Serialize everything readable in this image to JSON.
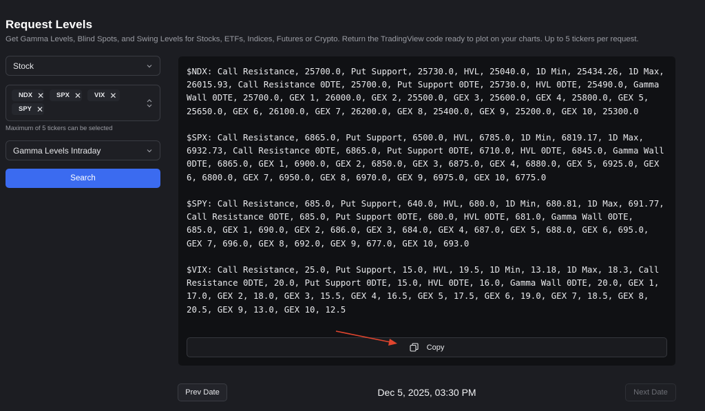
{
  "header": {
    "title": "Request Levels",
    "subtitle": "Get Gamma Levels, Blind Spots, and Swing Levels for Stocks, ETFs, Indices, Futures or Crypto. Return the TradingView code ready to plot on your charts. Up to 5 tickers per request."
  },
  "sidebar": {
    "asset_type": "Stock",
    "tickers": [
      "NDX",
      "SPX",
      "VIX",
      "SPY"
    ],
    "ticker_hint": "Maximum of 5 tickers can be selected",
    "level_type": "Gamma Levels Intraday",
    "search_label": "Search"
  },
  "output": {
    "blocks": [
      "$NDX: Call Resistance, 25700.0, Put Support, 25730.0, HVL, 25040.0, 1D Min, 25434.26, 1D Max, 26015.93, Call Resistance 0DTE, 25700.0, Put Support 0DTE, 25730.0, HVL 0DTE, 25490.0, Gamma Wall 0DTE, 25700.0, GEX 1, 26000.0, GEX 2, 25500.0, GEX 3, 25600.0, GEX 4, 25800.0, GEX 5, 25650.0, GEX 6, 26100.0, GEX 7, 26200.0, GEX 8, 25400.0, GEX 9, 25200.0, GEX 10, 25300.0",
      "$SPX: Call Resistance, 6865.0, Put Support, 6500.0, HVL, 6785.0, 1D Min, 6819.17, 1D Max, 6932.73, Call Resistance 0DTE, 6865.0, Put Support 0DTE, 6710.0, HVL 0DTE, 6845.0, Gamma Wall 0DTE, 6865.0, GEX 1, 6900.0, GEX 2, 6850.0, GEX 3, 6875.0, GEX 4, 6880.0, GEX 5, 6925.0, GEX 6, 6800.0, GEX 7, 6950.0, GEX 8, 6970.0, GEX 9, 6975.0, GEX 10, 6775.0",
      "$SPY: Call Resistance, 685.0, Put Support, 640.0, HVL, 680.0, 1D Min, 680.81, 1D Max, 691.77, Call Resistance 0DTE, 685.0, Put Support 0DTE, 680.0, HVL 0DTE, 681.0, Gamma Wall 0DTE, 685.0, GEX 1, 690.0, GEX 2, 686.0, GEX 3, 684.0, GEX 4, 687.0, GEX 5, 688.0, GEX 6, 695.0, GEX 7, 696.0, GEX 8, 692.0, GEX 9, 677.0, GEX 10, 693.0",
      "$VIX: Call Resistance, 25.0, Put Support, 15.0, HVL, 19.5, 1D Min, 13.18, 1D Max, 18.3, Call Resistance 0DTE, 20.0, Put Support 0DTE, 15.0, HVL 0DTE, 16.0, Gamma Wall 0DTE, 20.0, GEX 1, 17.0, GEX 2, 18.0, GEX 3, 15.5, GEX 4, 16.5, GEX 5, 17.5, GEX 6, 19.0, GEX 7, 18.5, GEX 8, 20.5, GEX 9, 13.0, GEX 10, 12.5"
    ],
    "copy_label": "Copy"
  },
  "pagination": {
    "prev_label": "Prev Date",
    "date": "Dec 5, 2025, 03:30 PM",
    "next_label": "Next Date"
  },
  "colors": {
    "accent": "#3b6bf0",
    "annotation_arrow": "#e0452e"
  }
}
